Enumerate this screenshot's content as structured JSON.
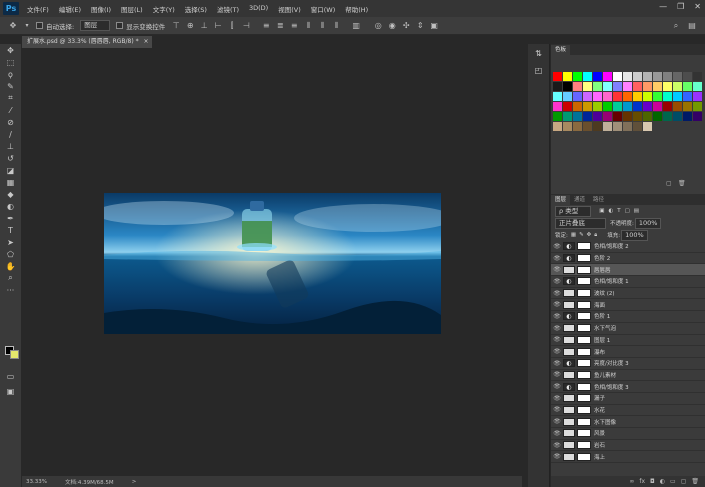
{
  "app": {
    "logo": "Ps"
  },
  "menu": [
    "文件(F)",
    "编辑(E)",
    "图像(I)",
    "图层(L)",
    "文字(Y)",
    "选择(S)",
    "滤镜(T)",
    "3D(D)",
    "视图(V)",
    "窗口(W)",
    "帮助(H)"
  ],
  "window_buttons": [
    "—",
    "❐",
    "✕"
  ],
  "options": {
    "auto_select_label": "自动选择:",
    "auto_select_value": "图层",
    "show_transform_label": "显示变换控件"
  },
  "document": {
    "tab_title": "扩展水.psd @ 33.3% (唇唇唇, RGB/8) *",
    "close": "×"
  },
  "status": {
    "zoom": "33.33%",
    "doc_size": "文档:4.39M/68.5M",
    "arrow": ">"
  },
  "swatches_panel": {
    "tab": "色板",
    "colors": [
      "#ff0000",
      "#ffff00",
      "#00ff00",
      "#00ffff",
      "#0000ff",
      "#ff00ff",
      "#ffffff",
      "#e6e6e6",
      "#cccccc",
      "#b3b3b3",
      "#999999",
      "#808080",
      "#666666",
      "#4d4d4d",
      "#333333",
      "#1a1a1a",
      "#000000",
      "#ff8080",
      "#ffff80",
      "#80ff80",
      "#80ffff",
      "#8080ff",
      "#ff80ff",
      "#ff6060",
      "#ff9966",
      "#ffcc66",
      "#ffff66",
      "#ccff66",
      "#66ff66",
      "#66ffcc",
      "#66ffff",
      "#66ccff",
      "#6666ff",
      "#cc66ff",
      "#ff66ff",
      "#ff66cc",
      "#ff3333",
      "#ff6600",
      "#ffcc00",
      "#ccff00",
      "#33ff33",
      "#00ffcc",
      "#00ccff",
      "#3366ff",
      "#9933ff",
      "#ff33cc",
      "#cc0000",
      "#cc6600",
      "#cc9900",
      "#99cc00",
      "#00cc00",
      "#00cc99",
      "#0099cc",
      "#0033cc",
      "#6600cc",
      "#cc0099",
      "#990000",
      "#994c00",
      "#997300",
      "#739900",
      "#009900",
      "#009973",
      "#007399",
      "#002699",
      "#4d0099",
      "#990073",
      "#660000",
      "#663300",
      "#664d00",
      "#4d6600",
      "#006600",
      "#00664d",
      "#004d66",
      "#001a66",
      "#330066",
      "#c8a882",
      "#a88a60",
      "#8a6a40",
      "#6a4f2d",
      "#4d3a20",
      "#c0b09a",
      "#a0907a",
      "#80705a",
      "#60503a",
      "#d8c8b0"
    ]
  },
  "layers_panel": {
    "tabs": [
      "图层",
      "通道",
      "路径"
    ],
    "kind_label": "ρ 类型",
    "blend_mode": "正片叠底",
    "opacity_label": "不透明度:",
    "opacity_value": "100%",
    "lock_label": "锁定:",
    "fill_label": "填充:",
    "fill_value": "100%",
    "layers": [
      {
        "name": "色相/饱和度 2",
        "type": "adj",
        "selected": false
      },
      {
        "name": "色阶 2",
        "type": "adj",
        "selected": false
      },
      {
        "name": "唇唇唇",
        "type": "img",
        "selected": true
      },
      {
        "name": "色相/饱和度 1",
        "type": "adj",
        "selected": false
      },
      {
        "name": "波纹 (2)",
        "type": "img",
        "selected": false
      },
      {
        "name": "海面",
        "type": "img",
        "selected": false
      },
      {
        "name": "色阶 1",
        "type": "adj",
        "selected": false
      },
      {
        "name": "水下气泡",
        "type": "img",
        "selected": false
      },
      {
        "name": "图层 1",
        "type": "img",
        "selected": false
      },
      {
        "name": "瀑布",
        "type": "img",
        "selected": false
      },
      {
        "name": "亮度/对比度 3",
        "type": "adj",
        "selected": false
      },
      {
        "name": "鱼儿素材",
        "type": "img",
        "selected": false
      },
      {
        "name": "色相/饱和度 3",
        "type": "adj",
        "selected": false
      },
      {
        "name": "漏子",
        "type": "img",
        "selected": false
      },
      {
        "name": "水花",
        "type": "img",
        "selected": false
      },
      {
        "name": "水下图像",
        "type": "img",
        "selected": false
      },
      {
        "name": "风景",
        "type": "img",
        "selected": false
      },
      {
        "name": "岩石",
        "type": "img",
        "selected": false
      },
      {
        "name": "海上",
        "type": "img",
        "selected": false
      }
    ]
  }
}
